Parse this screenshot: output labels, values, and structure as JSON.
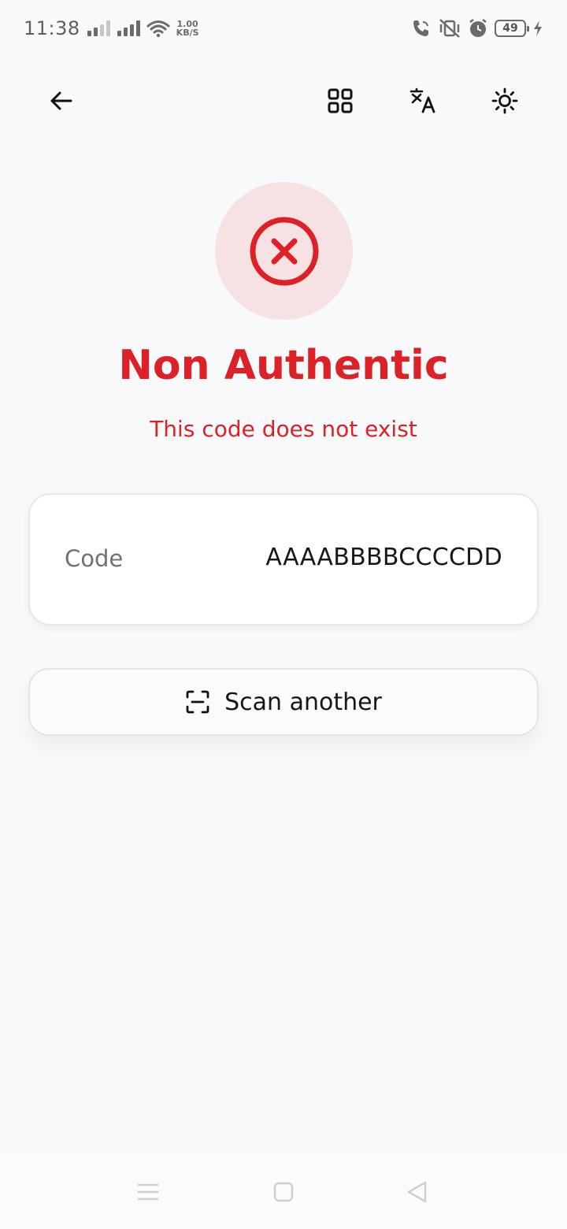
{
  "status_bar": {
    "time": "11:38",
    "net_speed_value": "1.00",
    "net_speed_unit": "KB/S",
    "battery_level": "49"
  },
  "app_bar": {
    "icons": [
      "back-arrow-icon",
      "qr-code-icon",
      "translate-icon",
      "brightness-icon"
    ]
  },
  "result": {
    "status_icon": "error-x-icon",
    "title": "Non Authentic",
    "subtitle": "This code does not exist",
    "accent_color": "#dc2228",
    "circle_color": "#f6e1e3"
  },
  "code_card": {
    "label": "Code",
    "value": "AAAABBBBCCCCDD"
  },
  "scan_button": {
    "icon": "scan-frame-icon",
    "label": "Scan another"
  },
  "nav_bar": {
    "icons": [
      "menu-icon",
      "home-square-icon",
      "back-triangle-icon"
    ]
  }
}
